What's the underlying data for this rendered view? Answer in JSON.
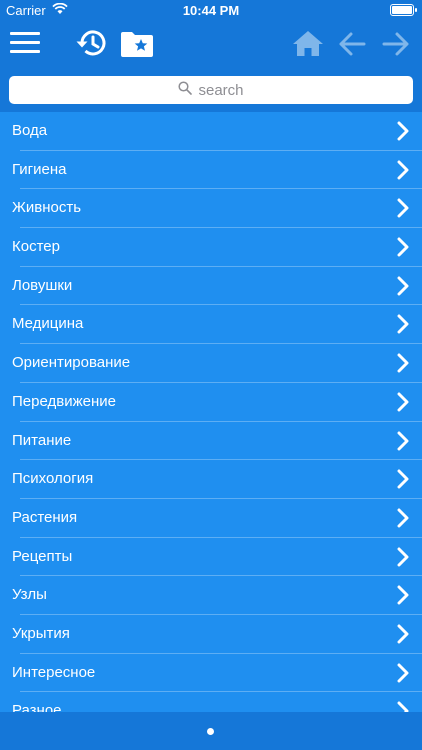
{
  "status_bar": {
    "carrier": "Carrier",
    "time": "10:44 PM"
  },
  "toolbar": {
    "icons": [
      "menu-icon",
      "history-icon",
      "favorites-folder-icon",
      "home-icon",
      "back-arrow-icon",
      "forward-arrow-icon"
    ]
  },
  "search": {
    "placeholder": "search"
  },
  "list": {
    "items": [
      {
        "label": "Вода"
      },
      {
        "label": "Гигиена"
      },
      {
        "label": "Живность"
      },
      {
        "label": "Костер"
      },
      {
        "label": "Ловушки"
      },
      {
        "label": "Медицина"
      },
      {
        "label": "Ориентирование"
      },
      {
        "label": "Передвижение"
      },
      {
        "label": "Питание"
      },
      {
        "label": "Психология"
      },
      {
        "label": "Растения"
      },
      {
        "label": "Рецепты"
      },
      {
        "label": "Узлы"
      },
      {
        "label": "Укрытия"
      },
      {
        "label": "Интересное"
      },
      {
        "label": "Разное"
      }
    ]
  },
  "colors": {
    "toolbar_bg": "#1577d8",
    "list_bg": "#1f8ff0",
    "disabled_icon": "#7fb6ea"
  }
}
